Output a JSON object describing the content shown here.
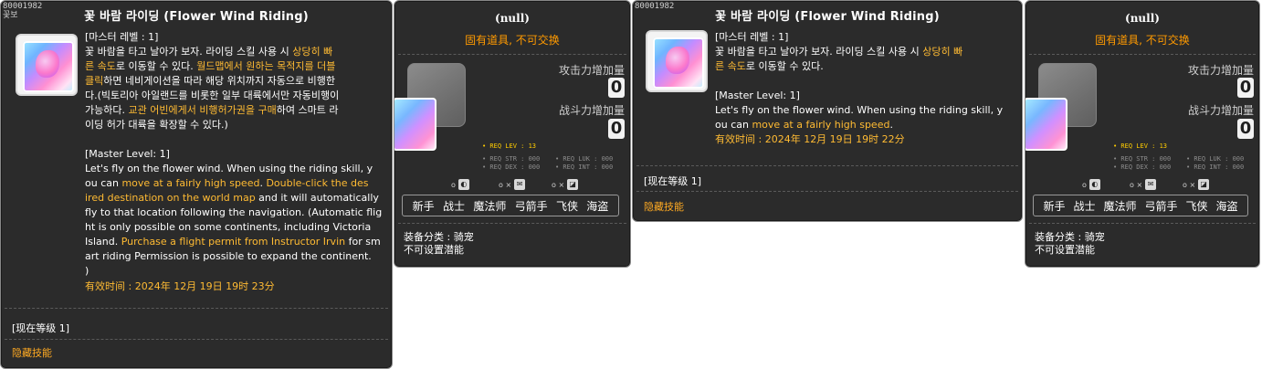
{
  "skill_id": "80001982",
  "skill_id_sub": "꽃보",
  "skill_title": "꽃 바람 라이딩 (Flower Wind Riding)",
  "panel1": {
    "kor_desc": [
      {
        "text": "[마스터 레벨 : 1]",
        "hl": false
      },
      {
        "text": "꽃 바람을 타고 날아가 보자. 라이딩 스킬 사용 시 ",
        "hl": false
      },
      {
        "text": "상당히 빠",
        "hl": true
      },
      {
        "text": "른 속도",
        "hl": true
      },
      {
        "text": "로 이동할 수 있다. ",
        "hl": false
      },
      {
        "text": "월드맵에서 원하는 목적지를 더블",
        "hl": true
      },
      {
        "text": "클릭",
        "hl": true
      },
      {
        "text": "하면 네비게이션을 따라 해당 위치까지 자동으로 비행한",
        "hl": false
      },
      {
        "text": "다.(빅토리아 아일랜드를 비롯한 일부 대륙에서만 자동비행이",
        "hl": false
      },
      {
        "text": "가능하다. ",
        "hl": false
      },
      {
        "text": "교관 어빈에게서 비행허가권을 구매",
        "hl": true
      },
      {
        "text": "하여 스마트 라",
        "hl": false
      },
      {
        "text": "이딩 허가 대륙을 확장할 수 있다.)",
        "hl": false
      }
    ],
    "eng_lines": [
      "[Master Level: 1]",
      "Let's fly on the flower wind. When using the riding skill, y",
      "ou can ",
      "move at a fairly high speed",
      ". ",
      "Double-click the des",
      "ired destination on the world map",
      " and it will automatically",
      "fly to that location following the navigation. (Automatic flig",
      "ht is only possible on some continents, including Victoria",
      "Island. ",
      "Purchase a flight permit from Instructor Irvin",
      " for sm",
      "art riding Permission is possible to expand the continent.",
      ")"
    ],
    "expire": "有效时间 : 2024年 12月 19日 19时 23分",
    "current_level": "[现在等级 1]",
    "hidden_skill": "隐藏技能"
  },
  "item_panel_a": {
    "null_title": "(null)",
    "fixed_item": "固有道具, 不可交换",
    "attack_label": "攻击力增加量",
    "attack_value": "0",
    "combat_label": "战斗力增加量",
    "combat_value": "0",
    "req_lev": "• REQ LEV : 13",
    "req_str": "• REQ STR : 000",
    "req_dex": "• REQ DEX : 000",
    "req_luk": "• REQ LUK : 000",
    "req_int": "• REQ INT : 000",
    "req_icons": [
      "o",
      "o ×",
      "o ×"
    ],
    "jobs": [
      "新手",
      "战士",
      "魔法师",
      "弓箭手",
      "飞侠",
      "海盗"
    ],
    "equip_type": "装备分类 : 骑宠",
    "no_potential": "不可设置潜能"
  },
  "panel3": {
    "kor_desc": [
      {
        "text": "[마스터 레벨 : 1]",
        "hl": false
      },
      {
        "text": "꽃 바람을 타고 날아가 보자. 라이딩 스킬 사용 시 ",
        "hl": false
      },
      {
        "text": "상당히 빠",
        "hl": true
      },
      {
        "text": "른 속도",
        "hl": true
      },
      {
        "text": "로 이동할 수 있다.",
        "hl": false
      }
    ],
    "eng_master": "[Master Level: 1]",
    "eng_line1": "Let's fly on the flower wind. When using the riding skill, y",
    "eng_line2a": "ou can ",
    "eng_line2b": "move at a fairly high speed",
    "eng_line2c": ".",
    "expire": "有效时间 : 2024年 12月 19日 19时 22分",
    "current_level": "[现在等级 1]",
    "hidden_skill": "隐藏技能"
  },
  "item_panel_b": {
    "null_title": "(null)",
    "fixed_item": "固有道具, 不可交换",
    "attack_label": "攻击力增加量",
    "attack_value": "0",
    "combat_label": "战斗力增加量",
    "combat_value": "0",
    "req_lev": "• REQ LEV : 13",
    "req_str": "• REQ STR : 000",
    "req_dex": "• REQ DEX : 000",
    "req_luk": "• REQ LUK : 000",
    "req_int": "• REQ INT : 000",
    "jobs": [
      "新手",
      "战士",
      "魔法师",
      "弓箭手",
      "飞侠",
      "海盗"
    ],
    "equip_type": "装备分类 : 骑宠",
    "no_potential": "不可设置潜能"
  }
}
